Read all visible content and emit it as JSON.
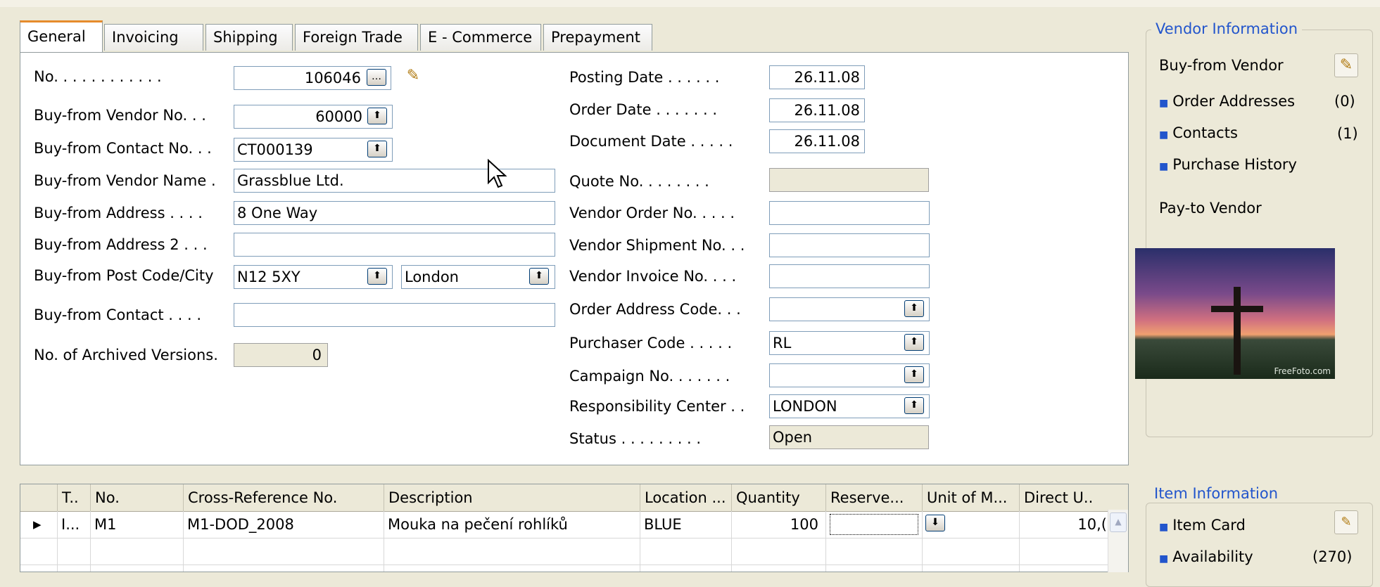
{
  "tabs": [
    "General",
    "Invoicing",
    "Shipping",
    "Foreign Trade",
    "E - Commerce",
    "Prepayment"
  ],
  "left_fields": [
    {
      "label": "No. . . . . . . . . . . .",
      "value": "106046"
    },
    {
      "label": "Buy-from Vendor No. . .",
      "value": "60000"
    },
    {
      "label": "Buy-from Contact No. . .",
      "value": "CT000139"
    },
    {
      "label": "Buy-from Vendor Name .",
      "value": "Grassblue Ltd."
    },
    {
      "label": "Buy-from Address . . . .",
      "value": "8 One Way"
    },
    {
      "label": "Buy-from Address 2 . . .",
      "value": ""
    },
    {
      "label": "Buy-from Post Code/City",
      "value": "N12 5XY",
      "value2": "London"
    },
    {
      "label": "Buy-from Contact . . . .",
      "value": ""
    },
    {
      "label": "No. of Archived Versions.",
      "value": "0"
    }
  ],
  "right_fields": [
    {
      "label": "Posting Date . . . . . .",
      "value": "26.11.08"
    },
    {
      "label": "Order Date . . . . . . .",
      "value": "26.11.08"
    },
    {
      "label": "Document Date . . . . .",
      "value": "26.11.08"
    },
    {
      "label": "Quote No. . . . . . . .",
      "value": ""
    },
    {
      "label": "Vendor Order No. . . . .",
      "value": ""
    },
    {
      "label": "Vendor Shipment No. . .",
      "value": ""
    },
    {
      "label": "Vendor Invoice No. . . .",
      "value": ""
    },
    {
      "label": "Order Address Code. . .",
      "value": ""
    },
    {
      "label": "Purchaser Code . . . . .",
      "value": "RL"
    },
    {
      "label": "Campaign No. . . . . . .",
      "value": ""
    },
    {
      "label": "Responsibility Center . .",
      "value": "LONDON"
    },
    {
      "label": "Status . . . . . . . . .",
      "value": "Open"
    }
  ],
  "vendor_info": {
    "title": "Vendor Information",
    "buy_from": "Buy-from Vendor",
    "order_addresses": "Order Addresses",
    "order_addresses_count": "(0)",
    "contacts": "Contacts",
    "contacts_count": "(1)",
    "purchase_history": "Purchase History",
    "pay_to": "Pay-to Vendor",
    "photo_watermark": "FreeFoto.com"
  },
  "item_info": {
    "title": "Item Information",
    "item_card": "Item Card",
    "availability": "Availability",
    "availability_count": "(270)"
  },
  "lines": {
    "headers": [
      "T..",
      "No.",
      "Cross-Reference No.",
      "Description",
      "Location ...",
      "Quantity",
      "Reserve...",
      "Unit of M...",
      "Direct U.."
    ],
    "rows": [
      {
        "type": "I...",
        "no": "M1",
        "cross_ref": "M1-DOD_2008",
        "description": "Mouka na pečení  rohlíků",
        "location": "BLUE",
        "quantity": "100",
        "reserve": "",
        "unit": "",
        "direct": "10,("
      }
    ]
  },
  "icons": {
    "lookup": "arrow-up-icon",
    "assist": "ellipsis-icon",
    "edit": "pencil-icon"
  },
  "colors": {
    "link": "#2255cc",
    "active_tab": "#e68b2c",
    "background": "#ece9d8"
  }
}
